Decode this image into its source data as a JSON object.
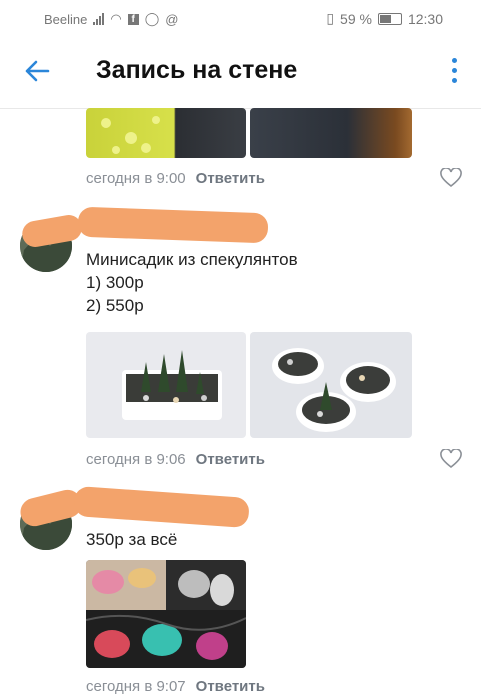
{
  "status": {
    "carrier": "Beeline",
    "battery": "59 %",
    "time": "12:30"
  },
  "header": {
    "title": "Запись на стене"
  },
  "comments": [
    {
      "time": "сегодня в 9:00",
      "reply": "Ответить"
    },
    {
      "text_lines": [
        "Минисадик из спекулянтов",
        "1) 300р",
        "2) 550р"
      ],
      "time": "сегодня в 9:06",
      "reply": "Ответить"
    },
    {
      "text_lines": [
        "350р за всё"
      ],
      "time": "сегодня в 9:07",
      "reply": "Ответить"
    }
  ],
  "icons": {
    "back": "arrow-left-icon",
    "more": "more-vertical-icon",
    "like": "heart-icon"
  },
  "colors": {
    "accent": "#2b86d9",
    "redaction": "#f3a36b"
  }
}
